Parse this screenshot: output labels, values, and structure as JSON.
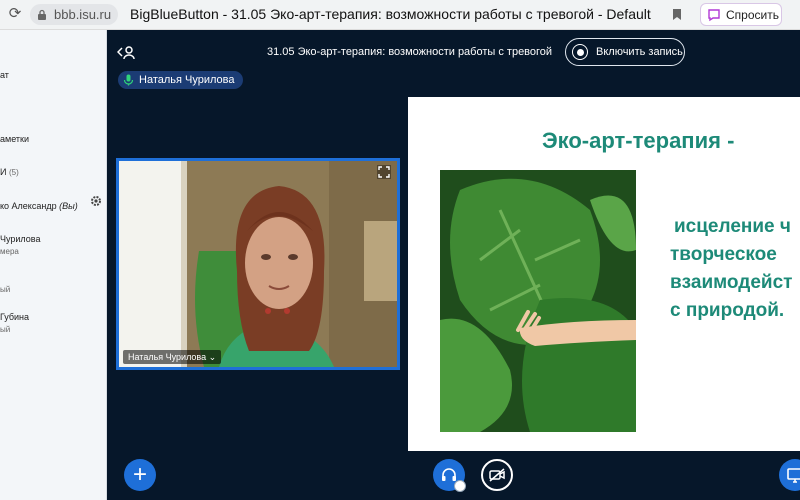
{
  "browser": {
    "url": "bbb.isu.ru",
    "tab_title": "BigBlueButton - 31.05 Эко-арт-терапия: возможности работы с тревогой - Default",
    "ask_button": "Спросить"
  },
  "sidebar": {
    "chat_label": "ат",
    "notes_label": "аметки",
    "users_header": "И",
    "users_count": "(5)",
    "users": [
      {
        "name": "ко Александр",
        "suffix": "(Вы)",
        "status": ""
      },
      {
        "name": "Чурилова",
        "suffix": "",
        "status": "мера"
      },
      {
        "name": "",
        "suffix": "",
        "status": "ый"
      },
      {
        "name": "Губина",
        "suffix": "",
        "status": "ый"
      }
    ]
  },
  "meeting": {
    "title": "31.05 Эко-арт-терапия: возможности работы с тревогой",
    "record_button": "Включить запись",
    "talking_indicator": "Наталья Чурилова"
  },
  "webcam": {
    "name_label": "Наталья Чурилова ⌄"
  },
  "slide": {
    "title": "Эко-арт-терапия -",
    "lines": [
      "исцеление ч",
      "творческое",
      "взаимодейст",
      "с природой."
    ]
  },
  "controls": {
    "plus_glyph": "+"
  },
  "colors": {
    "accent": "#1e6fd8",
    "background": "#06172a",
    "slide_text": "#1d8a78"
  },
  "icons": [
    "lock-icon",
    "bookmark-icon",
    "ask-icon",
    "gear-icon",
    "users-toggle-icon",
    "record-icon",
    "mic-icon",
    "expand-icon",
    "headset-icon",
    "camera-off-icon",
    "present-icon"
  ]
}
